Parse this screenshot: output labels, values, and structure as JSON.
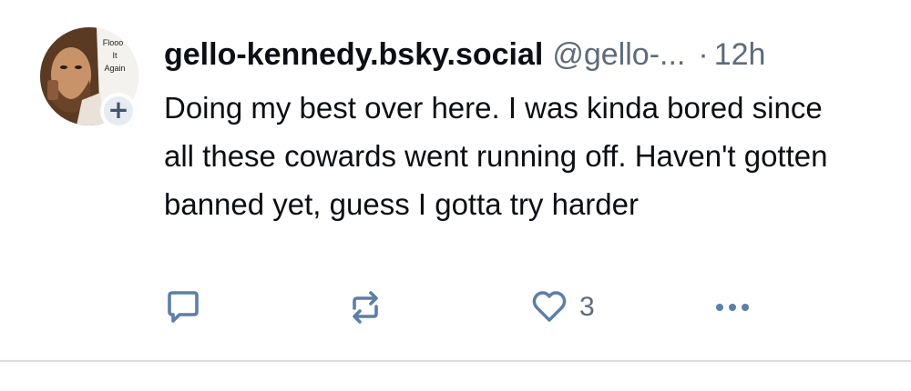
{
  "post": {
    "display_name": "gello-kennedy.bsky.social",
    "handle": "@gello-...",
    "separator": "·",
    "timestamp": "12h",
    "text": "Doing my best over here. I was kinda bored since all these cowards went running off. Haven't gotten banned yet, guess I gotta try harder",
    "avatar": {
      "overlay_text_lines": [
        "Flooo",
        "It",
        "Again"
      ],
      "follow_badge": "+"
    },
    "actions": {
      "reply_icon": "reply-icon",
      "repost_icon": "repost-icon",
      "like_icon": "heart-icon",
      "like_count": "3",
      "more_icon": "more-icon"
    }
  },
  "colors": {
    "text_primary": "#0b0f14",
    "text_secondary": "#5f6b7a",
    "icon_color": "#5b7fa8",
    "divider": "#d9dee6",
    "badge_bg": "#e7ecf3"
  }
}
